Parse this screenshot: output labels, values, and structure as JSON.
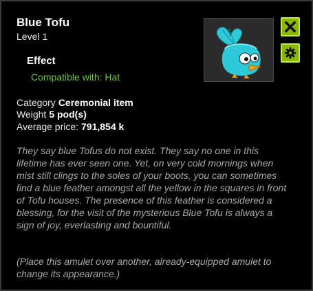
{
  "item": {
    "name": "Blue Tofu",
    "level": "Level  1",
    "effect_heading": "Effect",
    "effect_text": "Compatible with: Hat",
    "stats": [
      {
        "label": "Category",
        "value": "Ceremonial item"
      },
      {
        "label": "Weight",
        "value": "5 pod(s)"
      },
      {
        "label": "Average price:",
        "value": "791,854 k"
      }
    ],
    "description": "They say blue Tofus do not exist. They say no one in this lifetime has ever seen one. Yet, on very cold mornings when mist still clings to the soles of your boots, you can sometimes find a blue feather amongst all the yellow in the squares in front of Tofu houses. The presence of this feather is considered a blessing, for the visit of the mysterious Blue Tofu is always a sign of joy, everlasting and bountiful.",
    "note": "(Place this amulet over another, already-equipped amulet to change its appearance.)"
  },
  "controls": {
    "close_icon": "close-x-icon",
    "settings_icon": "gear-icon"
  },
  "colors": {
    "accent_green": "#8ab800",
    "effect_green": "#6fc04c",
    "item_blue": "#2ec9d8"
  }
}
